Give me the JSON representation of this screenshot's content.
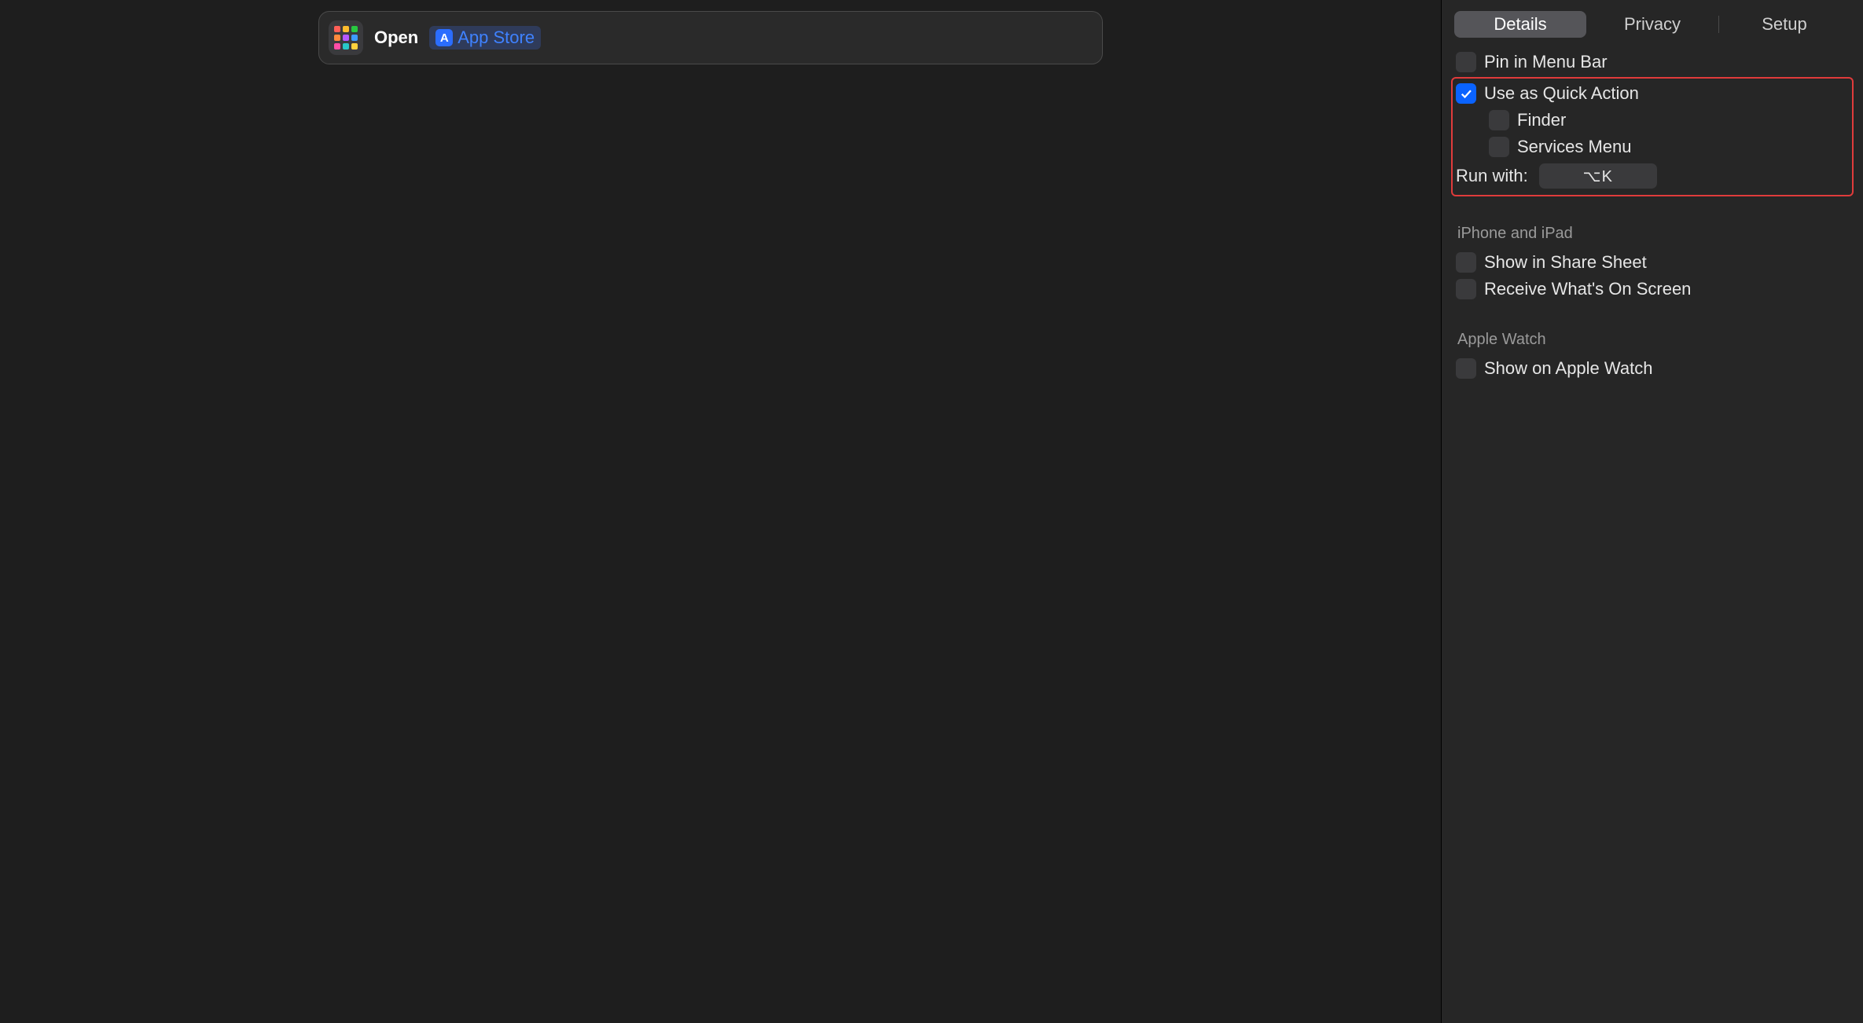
{
  "editor": {
    "action_label": "Open",
    "app_token": {
      "badge": "A",
      "label": "App Store"
    }
  },
  "tabs": {
    "details": "Details",
    "privacy": "Privacy",
    "setup": "Setup",
    "active": "details"
  },
  "mac": {
    "pin_menu_bar": {
      "label": "Pin in Menu Bar",
      "checked": false
    },
    "quick_action": {
      "label": "Use as Quick Action",
      "checked": true
    },
    "finder": {
      "label": "Finder",
      "checked": false
    },
    "services_menu": {
      "label": "Services Menu",
      "checked": false
    },
    "run_with_label": "Run with:",
    "run_with_value": "⌥K"
  },
  "ios": {
    "section_title": "iPhone and iPad",
    "share_sheet": {
      "label": "Show in Share Sheet",
      "checked": false
    },
    "on_screen": {
      "label": "Receive What's On Screen",
      "checked": false
    }
  },
  "watch": {
    "section_title": "Apple Watch",
    "show_on_watch": {
      "label": "Show on Apple Watch",
      "checked": false
    }
  },
  "icon_colors": [
    "#ff5f57",
    "#ffbd2e",
    "#28c840",
    "#ff8a3d",
    "#b558ff",
    "#3d9bff",
    "#ff4da6",
    "#28c8c8",
    "#ffd23d"
  ]
}
